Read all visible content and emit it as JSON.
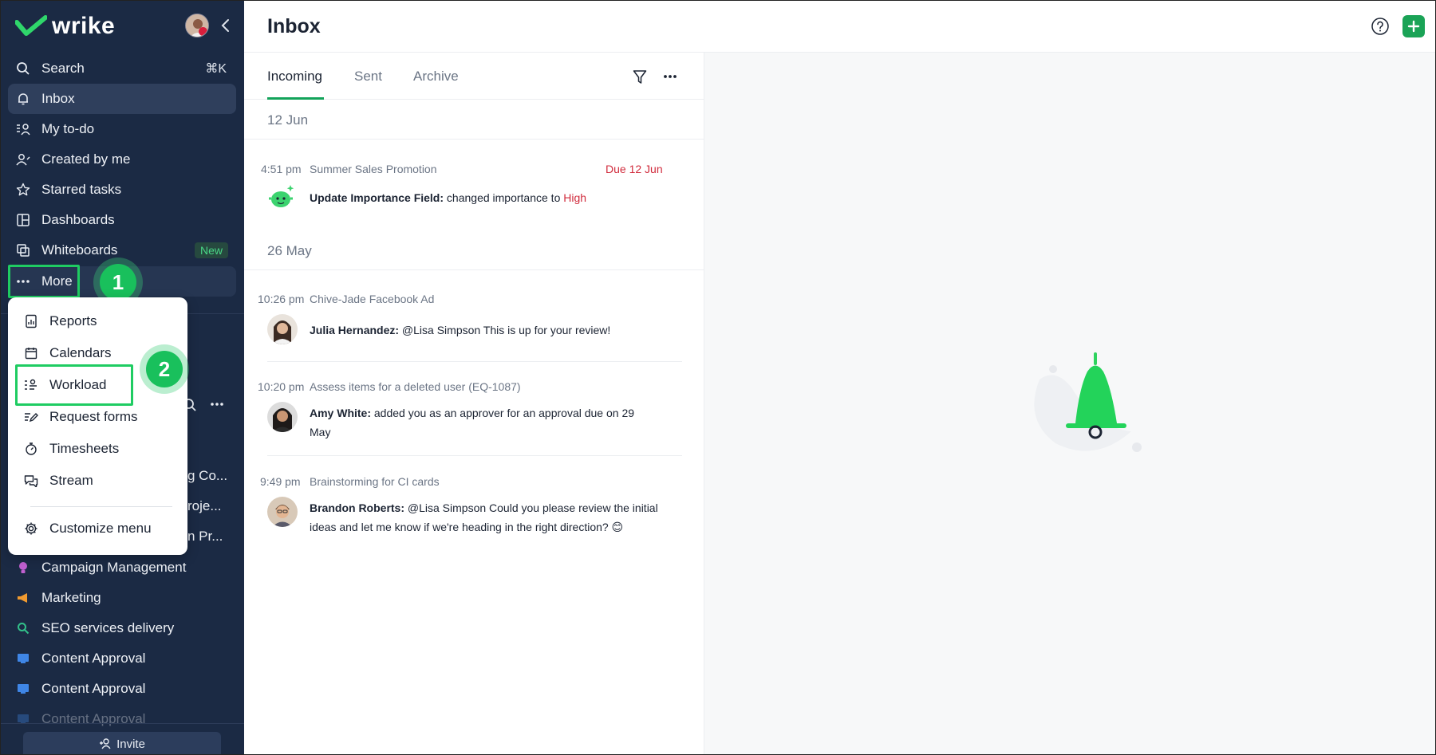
{
  "app": {
    "brand": "wrike",
    "page_title": "Inbox"
  },
  "sidebar": {
    "search": {
      "label": "Search",
      "shortcut": "⌘K"
    },
    "items": [
      {
        "id": "inbox",
        "label": "Inbox",
        "active": true
      },
      {
        "id": "my-todo",
        "label": "My to-do"
      },
      {
        "id": "created-by-me",
        "label": "Created by me"
      },
      {
        "id": "starred-tasks",
        "label": "Starred tasks"
      },
      {
        "id": "dashboards",
        "label": "Dashboards"
      },
      {
        "id": "whiteboards",
        "label": "Whiteboards",
        "badge": "New"
      },
      {
        "id": "more",
        "label": "More"
      }
    ],
    "fragments": [
      "g Co...",
      "roje...",
      "n Pr..."
    ],
    "projects": [
      {
        "label": "Campaign Management",
        "color": "#c060d0"
      },
      {
        "label": "Marketing",
        "color": "#f09a30"
      },
      {
        "label": "SEO services delivery",
        "color": "#32c08a"
      },
      {
        "label": "Content Approval",
        "color": "#3f86e6"
      },
      {
        "label": "Content Approval",
        "color": "#3f86e6"
      },
      {
        "label": "Content Approval",
        "color": "#3f86e6"
      }
    ],
    "invite_label": "Invite"
  },
  "more_menu": {
    "items": [
      {
        "label": "Reports",
        "icon": "reports-icon"
      },
      {
        "label": "Calendars",
        "icon": "calendar-icon"
      },
      {
        "label": "Workload",
        "icon": "workload-icon"
      },
      {
        "label": "Request forms",
        "icon": "request-forms-icon"
      },
      {
        "label": "Timesheets",
        "icon": "timesheets-icon"
      },
      {
        "label": "Stream",
        "icon": "stream-icon"
      }
    ],
    "customize": "Customize menu"
  },
  "steps": {
    "one": "1",
    "two": "2"
  },
  "tabs": [
    {
      "label": "Incoming",
      "active": true
    },
    {
      "label": "Sent"
    },
    {
      "label": "Archive"
    }
  ],
  "groups": [
    {
      "date": "12 Jun",
      "messages": [
        {
          "time": "4:51 pm",
          "task": "Summer Sales Promotion",
          "due": "Due 12 Jun",
          "author": "Update Importance Field:",
          "text": "changed importance to",
          "highlight": "High"
        }
      ]
    },
    {
      "date": "26 May",
      "messages": [
        {
          "time": "10:26 pm",
          "task": "Chive-Jade Facebook Ad",
          "author": "Julia Hernandez:",
          "text": "@Lisa Simpson This is up for your review!"
        },
        {
          "time": "10:20 pm",
          "task": "Assess items for a deleted user (EQ-1087)",
          "author": "Amy White:",
          "text_line1": "added you as an approver for an approval due on 29",
          "text_line2": "May"
        },
        {
          "time": "9:49 pm",
          "task": "Brainstorming for CI cards",
          "author": "Brandon Roberts:",
          "text_line1": "@Lisa Simpson Could you please review the initial",
          "text_line2": "ideas and let me know if we're heading in the right direction? 😊"
        }
      ]
    }
  ],
  "colors": {
    "sidebar_bg": "#1b2a44",
    "accent_green": "#1aa356",
    "step_green": "#19c05c",
    "due_red": "#d12c3d"
  }
}
